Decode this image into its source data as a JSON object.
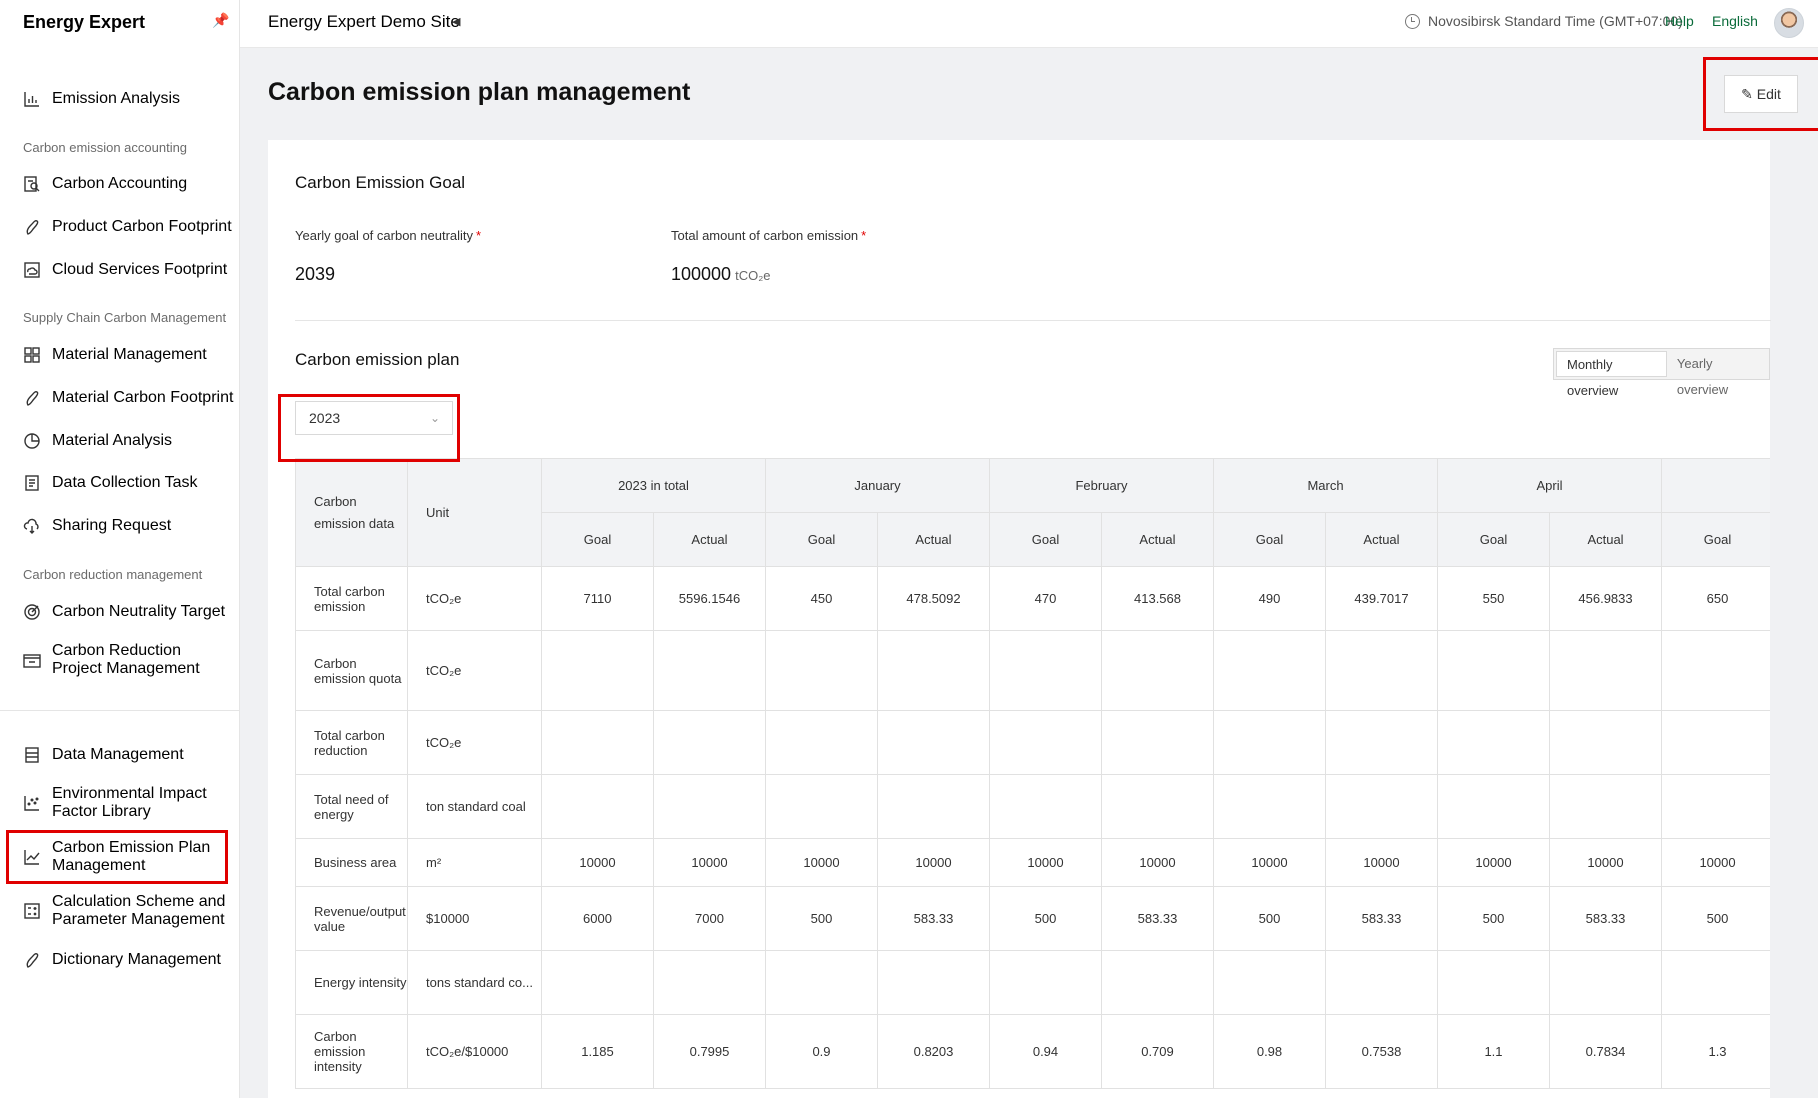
{
  "app": {
    "brand": "Energy Expert"
  },
  "sidebar": {
    "top_items": [
      {
        "label": "Emission Analysis",
        "icon": "bar-chart-icon"
      }
    ],
    "section1": "Carbon emission accounting",
    "section1_items": [
      {
        "label": "Carbon Accounting",
        "icon": "search-document-icon"
      },
      {
        "label": "Product Carbon Footprint",
        "icon": "footprint-icon"
      },
      {
        "label": "Cloud Services Footprint",
        "icon": "cloud-service-icon"
      }
    ],
    "section2": "Supply Chain Carbon Management",
    "section2_items": [
      {
        "label": "Material Management",
        "icon": "material-icon"
      },
      {
        "label": "Material Carbon Footprint",
        "icon": "footprint-icon"
      },
      {
        "label": "Material Analysis",
        "icon": "pie-chart-icon"
      },
      {
        "label": "Data Collection Task",
        "icon": "task-list-icon"
      },
      {
        "label": "Sharing Request",
        "icon": "share-icon"
      }
    ],
    "section3": "Carbon reduction management",
    "section3_items": [
      {
        "label": "Carbon Neutrality Target",
        "icon": "target-icon"
      },
      {
        "label": "Carbon Reduction Project Management",
        "icon": "project-icon"
      }
    ],
    "bottom_items": [
      {
        "label": "Data Management",
        "icon": "database-icon"
      },
      {
        "label": "Environmental Impact Factor Library",
        "icon": "scatter-icon"
      },
      {
        "label": "Carbon Emission Plan Management",
        "icon": "line-chart-icon"
      },
      {
        "label": "Calculation Scheme and Parameter Management",
        "icon": "calculator-icon"
      },
      {
        "label": "Dictionary Management",
        "icon": "footprint-icon"
      }
    ]
  },
  "topbar": {
    "site": "Energy Expert Demo Site",
    "timezone": "Novosibirsk Standard Time (GMT+07:00)",
    "help": "Help",
    "language": "English"
  },
  "page": {
    "title": "Carbon emission plan management",
    "edit_label": "Edit",
    "goal_section": "Carbon Emission Goal",
    "yearly_goal_label": "Yearly goal of carbon neutrality",
    "yearly_goal_value": "2039",
    "total_amount_label": "Total amount of carbon emission",
    "total_amount_value": "100000",
    "total_amount_unit": "tCO₂e",
    "required_mark": "*",
    "plan_section": "Carbon emission plan",
    "view_monthly": "Monthly overview",
    "view_yearly": "Yearly overview",
    "year_selected": "2023"
  },
  "table": {
    "header_data": "Carbon emission data",
    "header_unit": "Unit",
    "groups": [
      "2023 in total",
      "January",
      "February",
      "March",
      "April",
      ""
    ],
    "sub_goal": "Goal",
    "sub_actual": "Actual",
    "rows": [
      {
        "label": "Total carbon emission",
        "unit": "tCO₂e",
        "values": [
          "7110",
          "5596.1546",
          "450",
          "478.5092",
          "470",
          "413.568",
          "490",
          "439.7017",
          "550",
          "456.9833",
          "650"
        ]
      },
      {
        "label": "Carbon emission quota",
        "unit": "tCO₂e",
        "values": [
          "",
          "",
          "",
          "",
          "",
          "",
          "",
          "",
          "",
          "",
          ""
        ]
      },
      {
        "label": "Total carbon reduction",
        "unit": "tCO₂e",
        "values": [
          "",
          "",
          "",
          "",
          "",
          "",
          "",
          "",
          "",
          "",
          ""
        ]
      },
      {
        "label": "Total need of energy",
        "unit": "ton standard coal",
        "values": [
          "",
          "",
          "",
          "",
          "",
          "",
          "",
          "",
          "",
          "",
          ""
        ]
      },
      {
        "label": "Business area",
        "unit": "m²",
        "values": [
          "10000",
          "10000",
          "10000",
          "10000",
          "10000",
          "10000",
          "10000",
          "10000",
          "10000",
          "10000",
          "10000"
        ]
      },
      {
        "label": "Revenue/output value",
        "unit": "$10000",
        "values": [
          "6000",
          "7000",
          "500",
          "583.33",
          "500",
          "583.33",
          "500",
          "583.33",
          "500",
          "583.33",
          "500"
        ]
      },
      {
        "label": "Energy intensity",
        "unit": "tons standard co...",
        "values": [
          "",
          "",
          "",
          "",
          "",
          "",
          "",
          "",
          "",
          "",
          ""
        ]
      },
      {
        "label": "Carbon emission intensity",
        "unit": "tCO₂e/$10000",
        "values": [
          "1.185",
          "0.7995",
          "0.9",
          "0.8203",
          "0.94",
          "0.709",
          "0.98",
          "0.7538",
          "1.1",
          "0.7834",
          "1.3"
        ]
      }
    ]
  },
  "colors": {
    "accent": "#0a6b3a",
    "highlight": "#e00000",
    "required": "#e00000"
  }
}
